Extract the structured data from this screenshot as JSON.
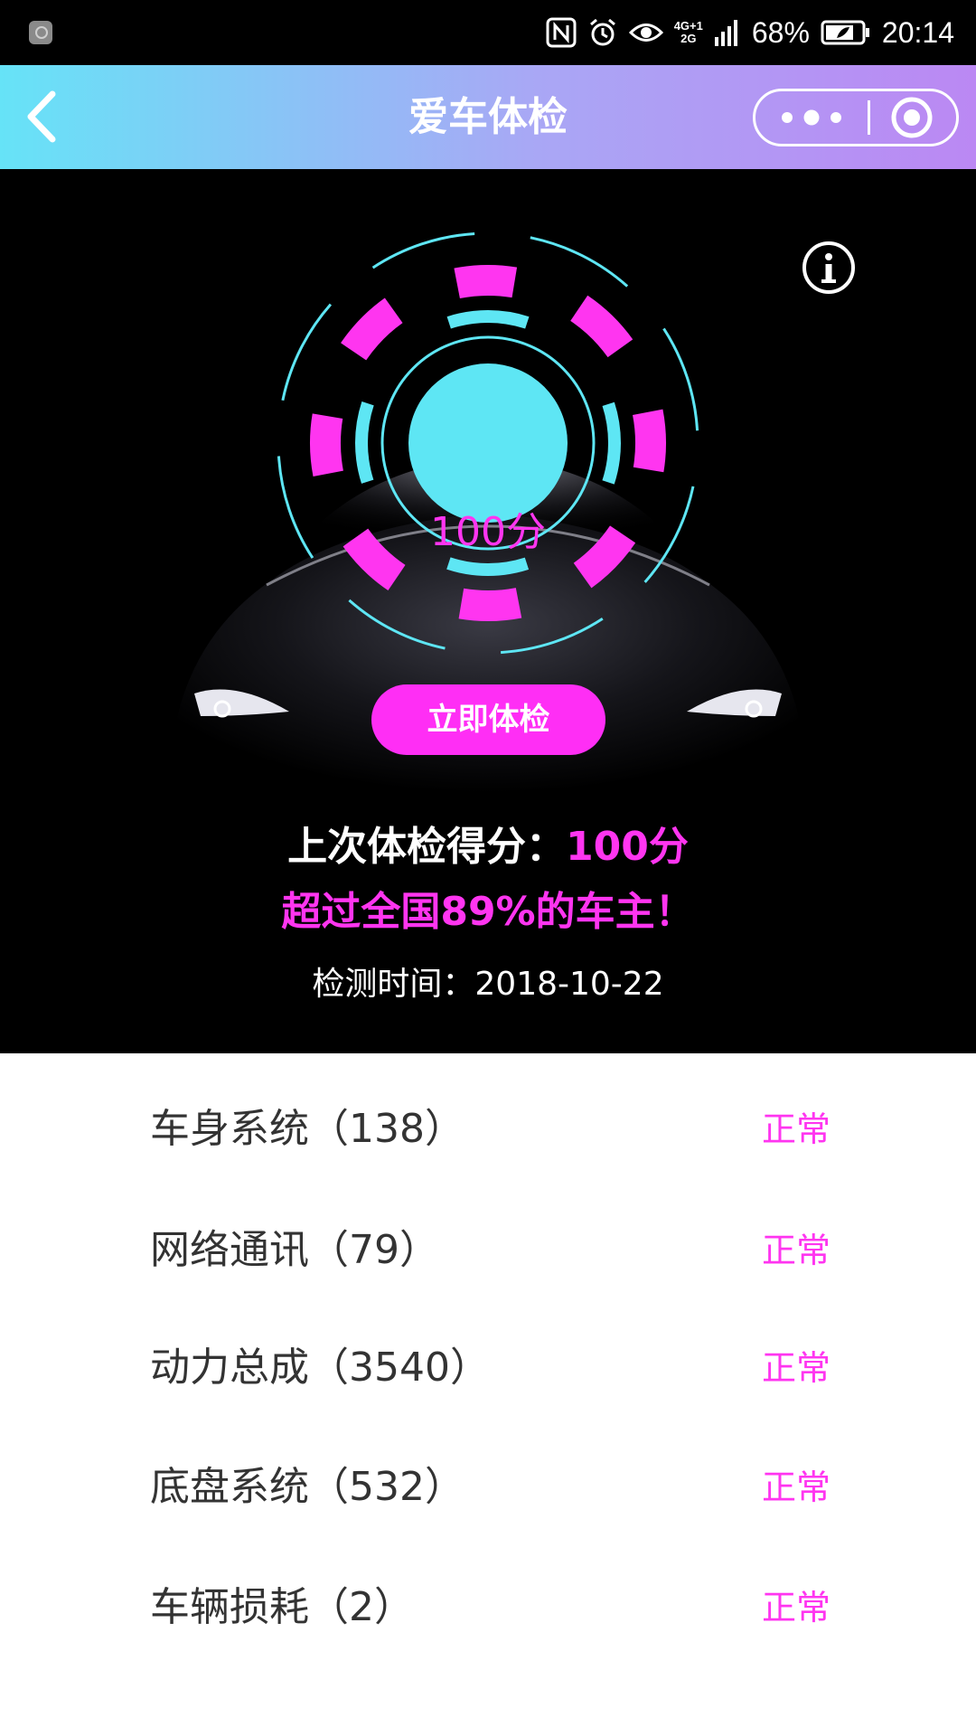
{
  "status_bar": {
    "battery": "68%",
    "time": "20:14",
    "network": "4G+1\n2G",
    "icons": [
      "app-badge-icon",
      "nfc-icon",
      "alarm-icon",
      "eye-icon",
      "signal-icon",
      "battery-icon"
    ]
  },
  "nav": {
    "title": "爱车体检",
    "icons": [
      "back-arrow-icon",
      "more-dots-icon",
      "close-target-icon"
    ]
  },
  "hero": {
    "score_badge": "100分",
    "check_button": "立即体检",
    "last_score_label": "上次体检得分：",
    "last_score_value": "100分",
    "rank_text": "超过全国89%的车主！",
    "check_time": "检测时间：2018-10-22",
    "icons": [
      "info-icon"
    ],
    "colors": {
      "accent_magenta": "#ff35f0",
      "accent_cyan": "#5ee6f4",
      "background": "#000000"
    }
  },
  "items": [
    {
      "label": "车身系统（138）",
      "status": "正常"
    },
    {
      "label": "网络通讯（79）",
      "status": "正常"
    },
    {
      "label": "动力总成（3540）",
      "status": "正常"
    },
    {
      "label": "底盘系统（532）",
      "status": "正常"
    },
    {
      "label": "车辆损耗（2）",
      "status": "正常"
    }
  ]
}
